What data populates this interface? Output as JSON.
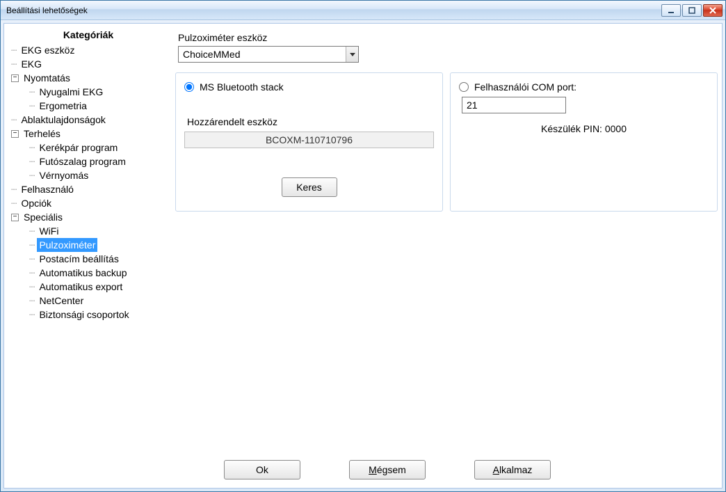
{
  "window": {
    "title": "Beállítási lehetőségek"
  },
  "sidebar": {
    "header": "Kategóriák",
    "items": [
      {
        "label": "EKG eszköz",
        "level": 0,
        "expander": null
      },
      {
        "label": "EKG",
        "level": 0,
        "expander": null
      },
      {
        "label": "Nyomtatás",
        "level": 0,
        "expander": "−"
      },
      {
        "label": "Nyugalmi EKG",
        "level": 1,
        "expander": null
      },
      {
        "label": "Ergometria",
        "level": 1,
        "expander": null
      },
      {
        "label": "Ablaktulajdonságok",
        "level": 0,
        "expander": null
      },
      {
        "label": "Terhelés",
        "level": 0,
        "expander": "−"
      },
      {
        "label": "Kerékpár program",
        "level": 1,
        "expander": null
      },
      {
        "label": "Futószalag program",
        "level": 1,
        "expander": null
      },
      {
        "label": "Vérnyomás",
        "level": 1,
        "expander": null
      },
      {
        "label": "Felhasználó",
        "level": 0,
        "expander": null
      },
      {
        "label": "Opciók",
        "level": 0,
        "expander": null
      },
      {
        "label": "Speciális",
        "level": 0,
        "expander": "−"
      },
      {
        "label": "WiFi",
        "level": 1,
        "expander": null
      },
      {
        "label": "Pulzoximéter",
        "level": 1,
        "expander": null,
        "selected": true
      },
      {
        "label": "Postacím beállítás",
        "level": 1,
        "expander": null
      },
      {
        "label": "Automatikus backup",
        "level": 1,
        "expander": null
      },
      {
        "label": "Automatikus export",
        "level": 1,
        "expander": null
      },
      {
        "label": "NetCenter",
        "level": 1,
        "expander": null
      },
      {
        "label": "Biztonsági csoportok",
        "level": 1,
        "expander": null
      }
    ]
  },
  "main": {
    "device_label": "Pulzoximéter eszköz",
    "device_value": "ChoiceMMed",
    "left_panel": {
      "radio_label": "MS Bluetooth stack",
      "radio_checked": true,
      "assigned_label": "Hozzárendelt eszköz",
      "assigned_value": "BCOXM-110710796",
      "search_button": "Keres"
    },
    "right_panel": {
      "radio_label": "Felhasználói COM port:",
      "radio_checked": false,
      "port_value": "21",
      "pin_label": "Készülék PIN: 0000"
    }
  },
  "buttons": {
    "ok": "Ok",
    "cancel_prefix": "M",
    "cancel_rest": "égsem",
    "apply_prefix": "A",
    "apply_rest": "lkalmaz"
  }
}
